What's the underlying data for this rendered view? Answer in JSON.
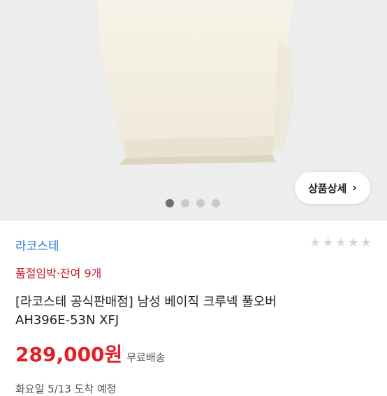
{
  "product_image": {
    "detail_button_label": "상품상세",
    "dots_total": 4,
    "active_index": 0
  },
  "brand": "라코스테",
  "rating": {
    "stars": 5,
    "filled": 0
  },
  "stock_notice": "품절임박·잔여 9개",
  "title_line1": "[라코스테 공식판매점] 남성 베이직 크루넥 풀오버",
  "title_line2": "AH396E-53N XFJ",
  "price": "289,000원",
  "shipping": "무료배송",
  "delivery_partial": "화요일 5/13 도착 예정",
  "colors": {
    "brand": "#2a7be4",
    "stock": "#c6202c",
    "price": "#e31e26"
  }
}
